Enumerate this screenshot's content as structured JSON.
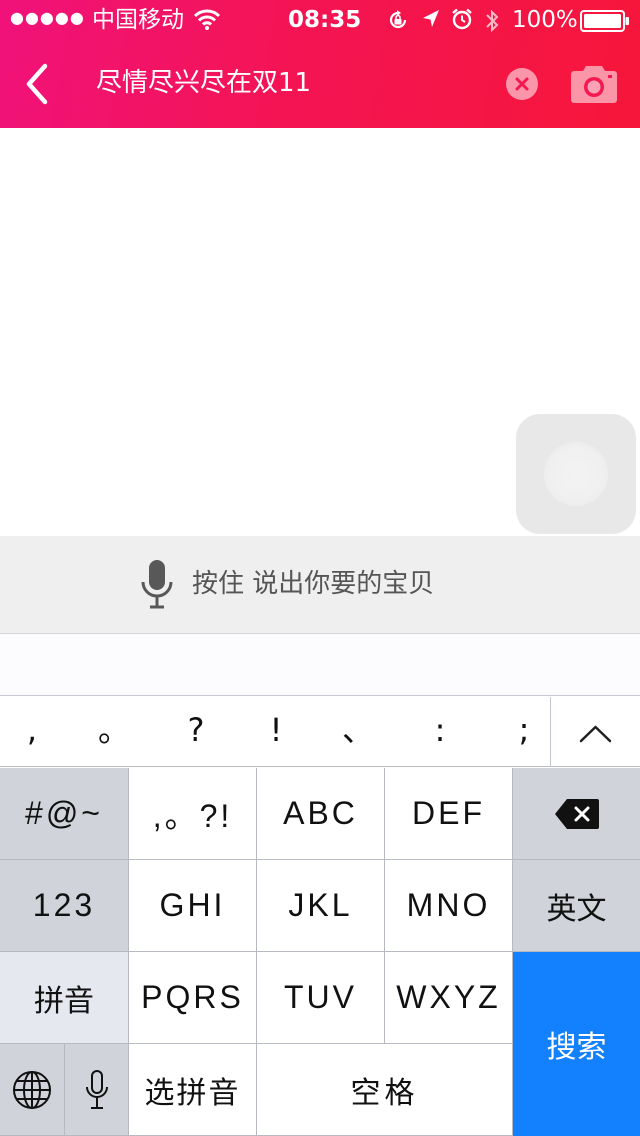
{
  "status_bar": {
    "signal": "●●●●●",
    "carrier": "中国移动",
    "wifi_icon": "wifi-icon",
    "time": "08:35",
    "battery_percent": "100%"
  },
  "search_bar": {
    "query": "尽情尽兴尽在双11",
    "back_icon": "chevron-left-icon",
    "clear_icon": "clear-circle-icon",
    "camera_icon": "camera-icon"
  },
  "voice": {
    "label": "按住  说出你要的宝贝",
    "icon": "microphone-icon"
  },
  "keyboard": {
    "punctuation": [
      ",",
      "。",
      "?",
      "!",
      "、",
      ":",
      ";"
    ],
    "collapse_icon": "chevron-up-icon",
    "keys": {
      "symbols": "#@~",
      "punct_key": ",。?!",
      "abc": "ABC",
      "def": "DEF",
      "numbers": "123",
      "ghi": "GHI",
      "jkl": "JKL",
      "mno": "MNO",
      "english": "英文",
      "pinyin": "拼音",
      "pqrs": "PQRS",
      "tuv": "TUV",
      "wxyz": "WXYZ",
      "search": "搜索",
      "choose_pinyin": "选拼音",
      "space": "空格"
    },
    "icons": {
      "delete": "backspace-icon",
      "globe": "globe-icon",
      "mic": "microphone-icon"
    }
  },
  "colors": {
    "header_gradient_start": "#f0127a",
    "header_gradient_end": "#f6163a",
    "search_key": "#1380fe"
  }
}
